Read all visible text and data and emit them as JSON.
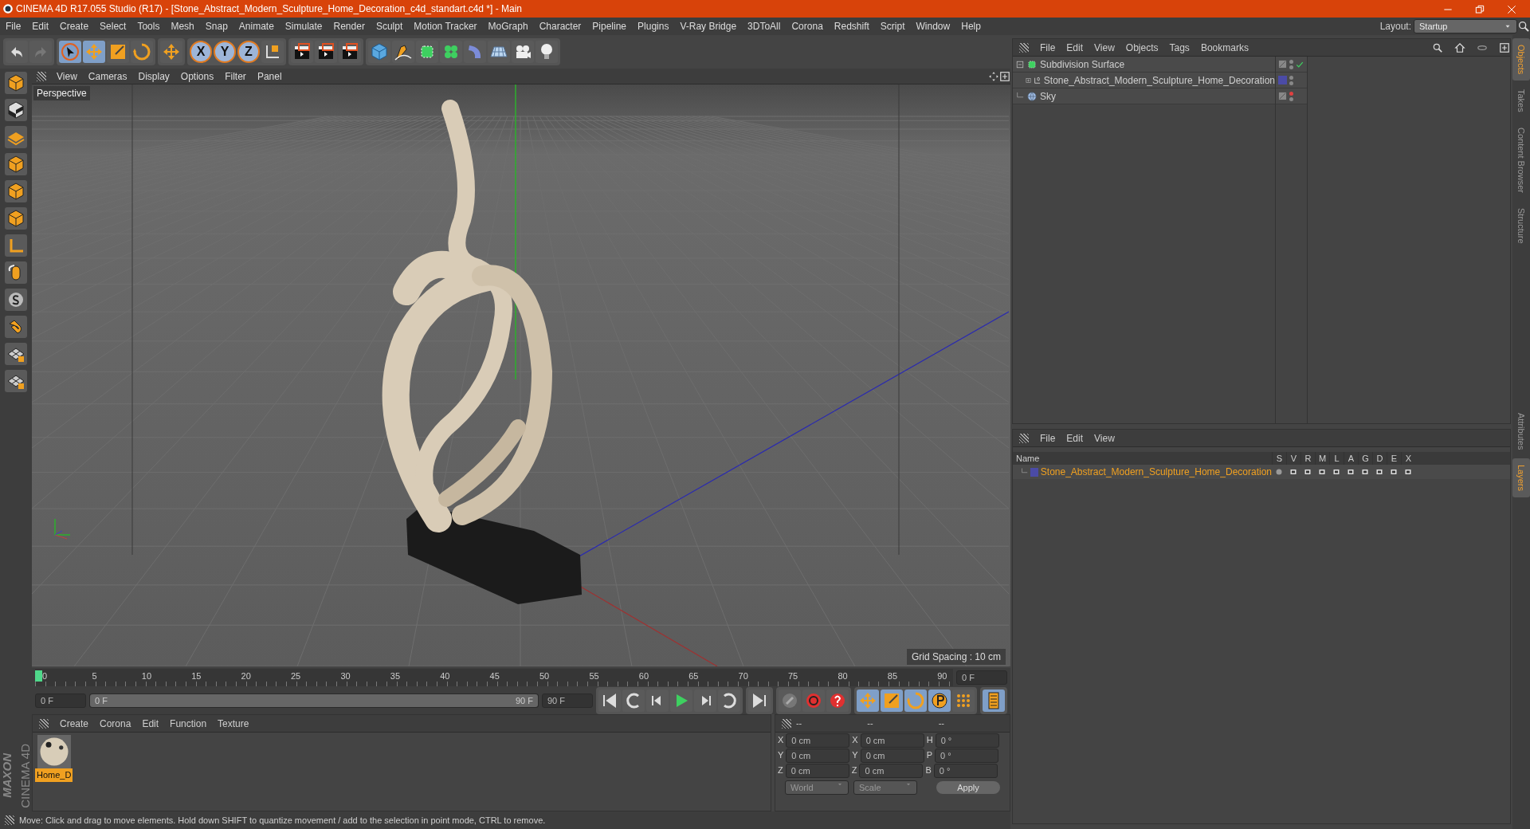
{
  "window": {
    "title": "CINEMA 4D R17.055 Studio (R17) - [Stone_Abstract_Modern_Sculpture_Home_Decoration_c4d_standart.c4d *] - Main"
  },
  "menu": [
    "File",
    "Edit",
    "Create",
    "Select",
    "Tools",
    "Mesh",
    "Snap",
    "Animate",
    "Simulate",
    "Render",
    "Sculpt",
    "Motion Tracker",
    "MoGraph",
    "Character",
    "Pipeline",
    "Plugins",
    "V-Ray Bridge",
    "3DToAll",
    "Corona",
    "Redshift",
    "Script",
    "Window",
    "Help"
  ],
  "layout": {
    "label": "Layout:",
    "value": "Startup"
  },
  "axis_buttons": [
    "X",
    "Y",
    "Z"
  ],
  "viewport": {
    "menu": [
      "View",
      "Cameras",
      "Display",
      "Options",
      "Filter",
      "Panel"
    ],
    "label": "Perspective",
    "grid_spacing": "Grid Spacing : 10 cm"
  },
  "timeline": {
    "ticks": [
      "0",
      "5",
      "10",
      "15",
      "20",
      "25",
      "30",
      "35",
      "40",
      "45",
      "50",
      "55",
      "60",
      "65",
      "70",
      "75",
      "80",
      "85",
      "90"
    ],
    "level": 0,
    "current": "0 F",
    "start": "0 F",
    "range": {
      "start": "0 F",
      "end": "90 F",
      "level": 1
    },
    "end": "90 F"
  },
  "materials": {
    "menu": [
      "Create",
      "Corona",
      "Edit",
      "Function",
      "Texture"
    ],
    "items": [
      {
        "name": "Home_D",
        "selected": true
      }
    ]
  },
  "coordinates": {
    "headers": [
      "--",
      "--",
      "--"
    ],
    "rows": [
      [
        {
          "label": "X",
          "value": "0 cm"
        },
        {
          "label": "X",
          "value": "0 cm"
        },
        {
          "label": "H",
          "value": "0 °"
        }
      ],
      [
        {
          "label": "Y",
          "value": "0 cm"
        },
        {
          "label": "Y",
          "value": "0 cm"
        },
        {
          "label": "P",
          "value": "0 °"
        }
      ],
      [
        {
          "label": "Z",
          "value": "0 cm"
        },
        {
          "label": "Z",
          "value": "0 cm"
        },
        {
          "label": "B",
          "value": "0 °"
        }
      ]
    ],
    "dropdowns": [
      "World",
      "Scale"
    ],
    "apply": "Apply"
  },
  "status_bar": "Move: Click and drag to move elements. Hold down SHIFT to quantize movement / add to the selection in point mode, CTRL to remove.",
  "brand": {
    "maker": "MAXON",
    "product": "CINEMA 4D"
  },
  "objects_panel": {
    "menu": [
      "File",
      "Edit",
      "View",
      "Objects",
      "Tags",
      "Bookmarks"
    ],
    "tree": [
      {
        "name": "Subdivision Surface",
        "kind": "subdivision",
        "expanded": true,
        "enabled": true,
        "editor_visible": true,
        "children": [
          {
            "name": "Stone_Abstract_Modern_Sculpture_Home_Decoration",
            "kind": "null",
            "expanded": false,
            "color": "#4b4ba6",
            "editor_visible": true
          }
        ]
      },
      {
        "name": "Sky",
        "kind": "sky",
        "editor_visible": false
      }
    ]
  },
  "layers_panel": {
    "menu": [
      "File",
      "Edit",
      "View"
    ],
    "columns": [
      "Name",
      "S",
      "V",
      "R",
      "M",
      "L",
      "A",
      "G",
      "D",
      "E",
      "X"
    ],
    "rows": [
      {
        "name": "Stone_Abstract_Modern_Sculpture_Home_Decoration",
        "color": "#4b4ba6"
      }
    ]
  },
  "side_tabs": [
    {
      "label": "Objects",
      "selected": true
    },
    {
      "label": "Takes",
      "selected": false
    },
    {
      "label": "Content Browser",
      "selected": false
    },
    {
      "label": "Structure",
      "selected": false
    },
    {
      "label": "Attributes",
      "selected": false
    },
    {
      "label": "Layers",
      "selected": true
    }
  ]
}
